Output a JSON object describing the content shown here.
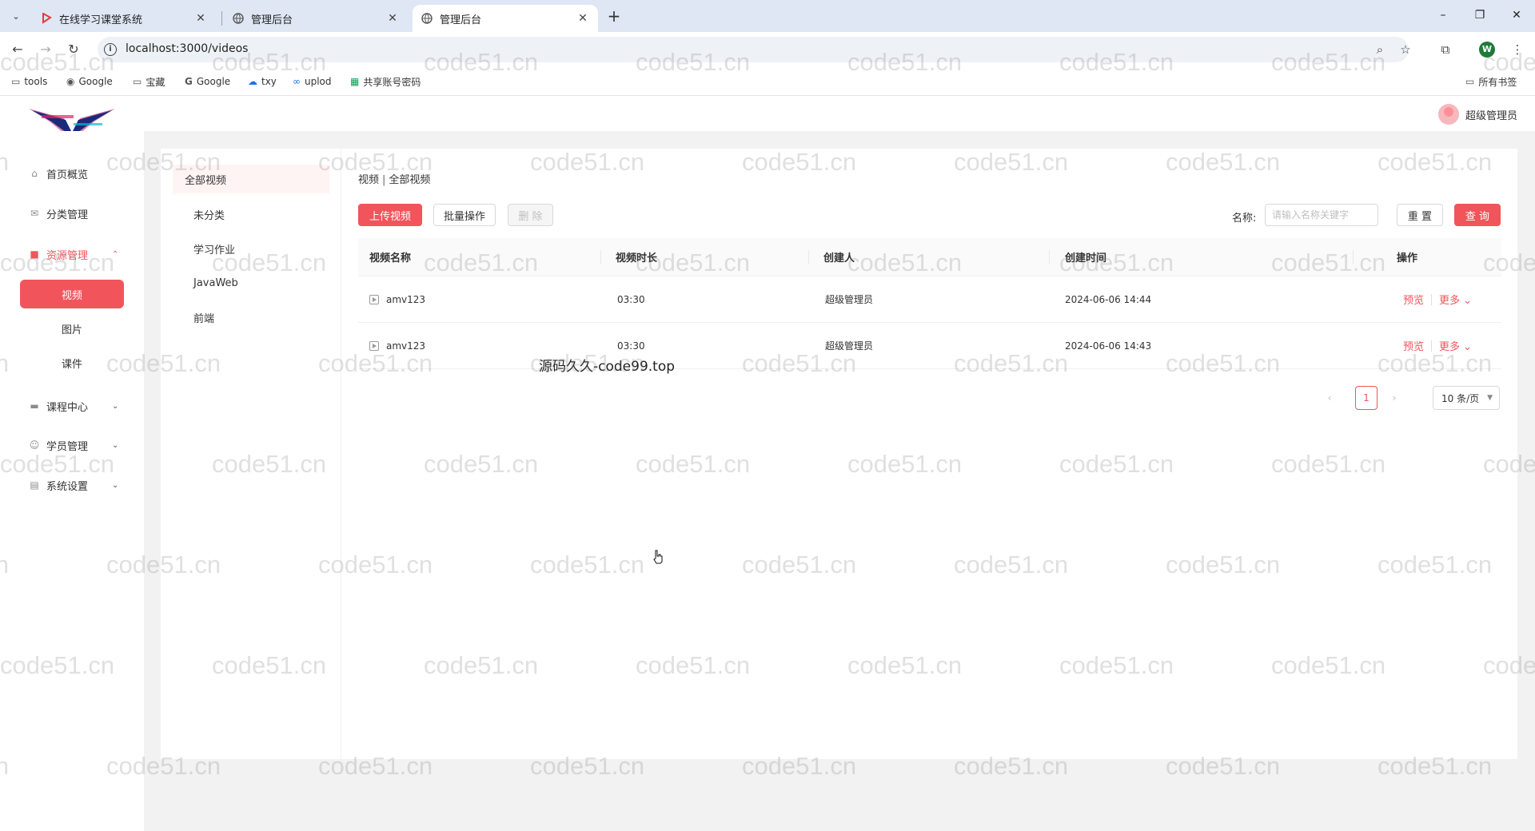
{
  "browser": {
    "tabs": [
      {
        "title": "在线学习课堂系统",
        "favicon": "p-logo-icon",
        "active": false
      },
      {
        "title": "管理后台",
        "favicon": "globe-icon",
        "active": false
      },
      {
        "title": "管理后台",
        "favicon": "globe-icon",
        "active": true
      }
    ],
    "new_tab": "+",
    "window_controls": {
      "minimize": "–",
      "restore": "❐",
      "close": "✕"
    },
    "url": "localhost:3000/videos",
    "profile_initial": "W",
    "bookmarks": [
      {
        "label": "tools",
        "icon": "folder-icon"
      },
      {
        "label": "Google",
        "icon": "globe-icon"
      },
      {
        "label": "宝藏",
        "icon": "folder-icon"
      },
      {
        "label": "Google",
        "icon": "google-icon"
      },
      {
        "label": "txy",
        "icon": "cloud-icon"
      },
      {
        "label": "uplod",
        "icon": "link-icon"
      },
      {
        "label": "共享账号密码",
        "icon": "sheet-icon"
      }
    ],
    "all_bookmarks": "所有书签"
  },
  "header": {
    "user_name": "超级管理员"
  },
  "sidebar": {
    "items": [
      {
        "label": "首页概览",
        "icon": "home-icon"
      },
      {
        "label": "分类管理",
        "icon": "category-icon"
      },
      {
        "label": "资源管理",
        "icon": "folder-icon",
        "open": true
      },
      {
        "label": "课程中心",
        "icon": "course-icon"
      },
      {
        "label": "学员管理",
        "icon": "user-icon"
      },
      {
        "label": "系统设置",
        "icon": "settings-icon"
      }
    ],
    "sub_items": [
      {
        "label": "视频",
        "active": true
      },
      {
        "label": "图片"
      },
      {
        "label": "课件"
      }
    ]
  },
  "categories": [
    "全部视频",
    "未分类",
    "学习作业",
    "JavaWeb",
    "前端"
  ],
  "breadcrumb": {
    "section": "视频",
    "separator": "|",
    "current": "全部视频"
  },
  "toolbar": {
    "upload": "上传视频",
    "batch": "批量操作",
    "delete": "删 除",
    "search_label": "名称:",
    "search_placeholder": "请输入名称关键字",
    "reset": "重 置",
    "query": "查 询"
  },
  "table": {
    "columns": [
      "视频名称",
      "视频时长",
      "创建人",
      "创建时间",
      "操作"
    ],
    "rows": [
      {
        "name": "amv123",
        "duration": "03:30",
        "creator": "超级管理员",
        "created": "2024-06-06 14:44",
        "preview": "预览",
        "more": "更多"
      },
      {
        "name": "amv123",
        "duration": "03:30",
        "creator": "超级管理员",
        "created": "2024-06-06 14:43",
        "preview": "预览",
        "more": "更多"
      }
    ]
  },
  "pagination": {
    "current_page": "1",
    "page_size": "10 条/页",
    "prev": "‹",
    "next": "›"
  },
  "overlay_text": "源码久久-code99.top",
  "watermark": "code51.cn",
  "colors": {
    "accent": "#f2545b",
    "sidebar_bg": "#ffffff",
    "page_bg": "#f2f2f2"
  }
}
